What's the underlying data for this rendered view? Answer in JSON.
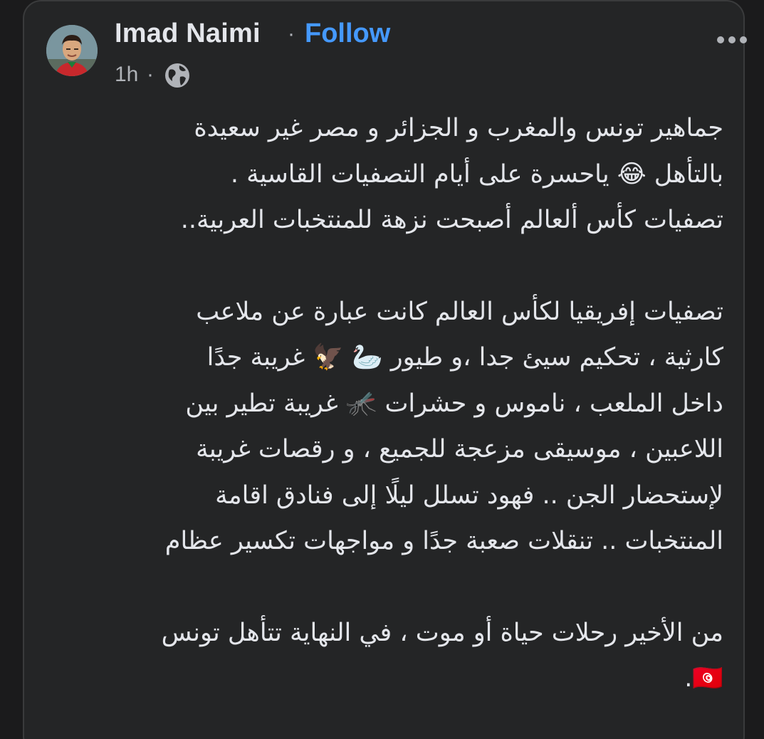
{
  "post": {
    "author": "Imad Naimi",
    "separator": "·",
    "follow_label": "Follow",
    "time": "1h",
    "time_separator": "·",
    "privacy_icon": "globe-icon",
    "more_icon": "more-horizontal-icon",
    "lines_block1": [
      "جماهير تونس والمغرب و الجزائر و مصر غير سعيدة",
      "بالتأهل 😂 ياحسرة على أيام التصفيات القاسية .",
      "تصفيات كأس ألعالم أصبحت نزهة للمنتخبات العربية.."
    ],
    "lines_block2": [
      "تصفيات إفريقيا لكأس العالم كانت عبارة عن ملاعب",
      "كارثية ، تحكيم سيئ جدا ،و طيور 🦢 🦅 غريبة جدًا",
      "داخل الملعب ، ناموس و حشرات 🦟 غريبة تطير بين",
      "اللاعبين ، موسيقى مزعجة للجميع ، و رقصات غريبة",
      "لإستحضار الجن .. فهود تسلل ليلًا إلى فنادق اقامة",
      "المنتخبات .. تنقلات صعبة جدًا و مواجهات تكسير عظام"
    ],
    "lines_block3": [
      "من الأخير رحلات حياة أو موت ، في النهاية تتأهل تونس",
      "🇹🇳."
    ]
  },
  "colors": {
    "background": "#1b1b1c",
    "card": "#242526",
    "text": "#e4e6eb",
    "secondary": "#b0b3b8",
    "link": "#4599ff"
  }
}
